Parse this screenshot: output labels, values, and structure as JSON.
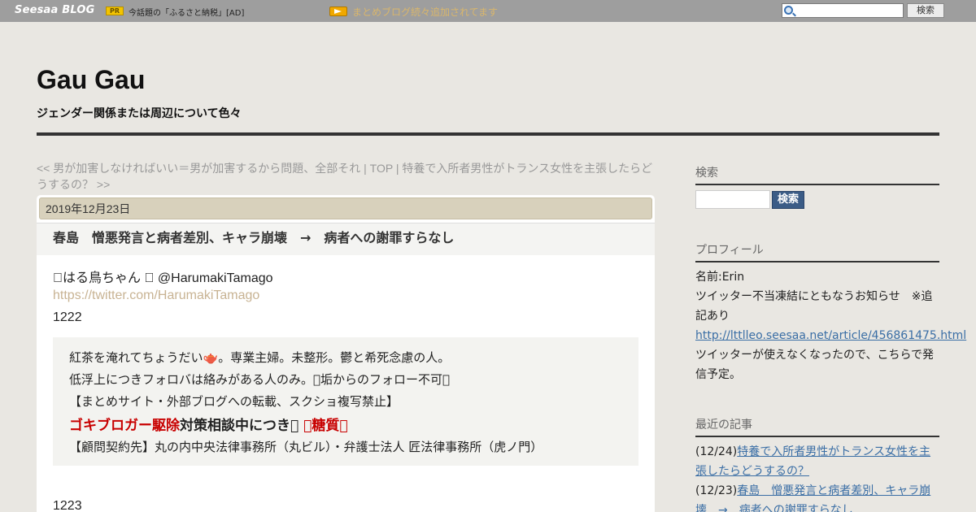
{
  "topbar": {
    "logo": "Seesaa BLOG",
    "pr_badge": "PR",
    "pr_text": "今話題の「ふるさと納税」[AD]",
    "news_text": "まとめブログ続々追加されてます",
    "search_button": "検索"
  },
  "header": {
    "title": "Gau Gau",
    "description": "ジェンダー関係または周辺について色々"
  },
  "post_nav": {
    "prev": "<< 男が加害しなければいい＝男が加害するから問題、全部それ",
    "separator1": " | ",
    "top": "TOP",
    "separator2": " | ",
    "next": "特養で入所者男性がトランス女性を主張したらどうするの？ >>"
  },
  "article": {
    "date": "2019年12月23日",
    "title": "春島　憎悪発言と病者差別、キャラ崩壊　→　病者への謝罪すらなし",
    "lines": {
      "user": "􀀀はる鳥ちゃん 􀀀 @HarumakiTamago",
      "url": "https://twitter.com/HarumakiTamago",
      "date1": "1222",
      "date2": "1223"
    },
    "quote": {
      "line1": "紅茶を淹れてちょうだい🫖。専業主婦。未整形。鬱と希死念慮の人。",
      "line2": "低浮上につきフォロバは絡みがある人のみ。􀀀垢からのフォロー不可􀀀",
      "line3": "【まとめサイト・外部ブログへの転載、スクショ複写禁止】",
      "line4_red1": "ゴキブロガー駆除",
      "line4_black": "対策相談中につき􀀀 ",
      "line4_red2": "􀀀糖質􀀀",
      "line5": "【顧問契約先】丸の内中央法律事務所（丸ビル）・弁護士法人 匠法律事務所（虎ノ門）"
    }
  },
  "sidebar": {
    "search_heading": "検索",
    "search_button": "検索",
    "profile_heading": "プロフィール",
    "profile_name": "名前:Erin",
    "profile_notice": "ツイッター不当凍結にともなうお知らせ　※追記あり",
    "profile_link": "http://lttlleo.seesaa.net/article/456861475.html",
    "profile_note": "ツイッターが使えなくなったので、こちらで発信予定。",
    "recent_heading": "最近の記事",
    "recent": [
      {
        "date": "(12/24)",
        "title": "特養で入所者男性がトランス女性を主張したらどうするの？"
      },
      {
        "date": "(12/23)",
        "title": "春島　憎悪発言と病者差別、キャラ崩壊　→　病者への謝罪すらなし"
      }
    ]
  }
}
